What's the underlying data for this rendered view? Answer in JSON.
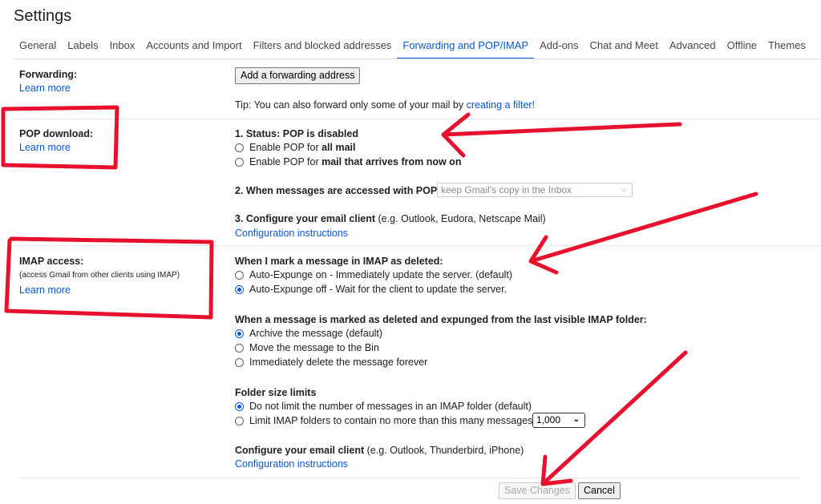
{
  "header": {
    "title": "Settings"
  },
  "tabs": [
    {
      "label": "General"
    },
    {
      "label": "Labels"
    },
    {
      "label": "Inbox"
    },
    {
      "label": "Accounts and Import"
    },
    {
      "label": "Filters and blocked addresses"
    },
    {
      "label": "Forwarding and POP/IMAP",
      "active": true
    },
    {
      "label": "Add-ons"
    },
    {
      "label": "Chat and Meet"
    },
    {
      "label": "Advanced"
    },
    {
      "label": "Offline"
    },
    {
      "label": "Themes"
    }
  ],
  "forwarding": {
    "label": "Forwarding:",
    "learn_more": "Learn more",
    "add_button": "Add a forwarding address",
    "tip_prefix": "Tip: You can also forward only some of your mail by ",
    "tip_link": "creating a filter!"
  },
  "pop": {
    "label": "POP download:",
    "learn_more": "Learn more",
    "status_label": "1. Status: POP is disabled",
    "option1_prefix": "Enable POP for ",
    "option1_bold": "all mail",
    "option2_prefix": "Enable POP for ",
    "option2_bold": "mail that arrives from now on",
    "accessed_label": "2. When messages are accessed with POP",
    "accessed_value": "keep Gmail's copy in the Inbox",
    "configure_bold": "3. Configure your email client",
    "configure_rest": " (e.g. Outlook, Eudora, Netscape Mail)",
    "config_link": "Configuration instructions"
  },
  "imap": {
    "label": "IMAP access:",
    "sublabel": "(access Gmail from other clients using IMAP)",
    "learn_more": "Learn more",
    "deleted_heading": "When I mark a message in IMAP as deleted:",
    "deleted_options": [
      {
        "label": "Auto-Expunge on - Immediately update the server. (default)",
        "selected": false
      },
      {
        "label": "Auto-Expunge off - Wait for the client to update the server.",
        "selected": true
      }
    ],
    "expunged_heading": "When a message is marked as deleted and expunged from the last visible IMAP folder:",
    "expunged_options": [
      {
        "label": "Archive the message (default)",
        "selected": true
      },
      {
        "label": "Move the message to the Bin",
        "selected": false
      },
      {
        "label": "Immediately delete the message forever",
        "selected": false
      }
    ],
    "folder_heading": "Folder size limits",
    "folder_options": [
      {
        "label": "Do not limit the number of messages in an IMAP folder (default)",
        "selected": true
      },
      {
        "label": "Limit IMAP folders to contain no more than this many messages",
        "selected": false
      }
    ],
    "folder_limit_value": "1,000",
    "configure_bold": "Configure your email client",
    "configure_rest": " (e.g. Outlook, Thunderbird, iPhone)",
    "config_link": "Configuration instructions"
  },
  "footer": {
    "save": "Save Changes",
    "cancel": "Cancel"
  },
  "colors": {
    "link": "#0b57d0",
    "annotation": "#e8112d"
  }
}
